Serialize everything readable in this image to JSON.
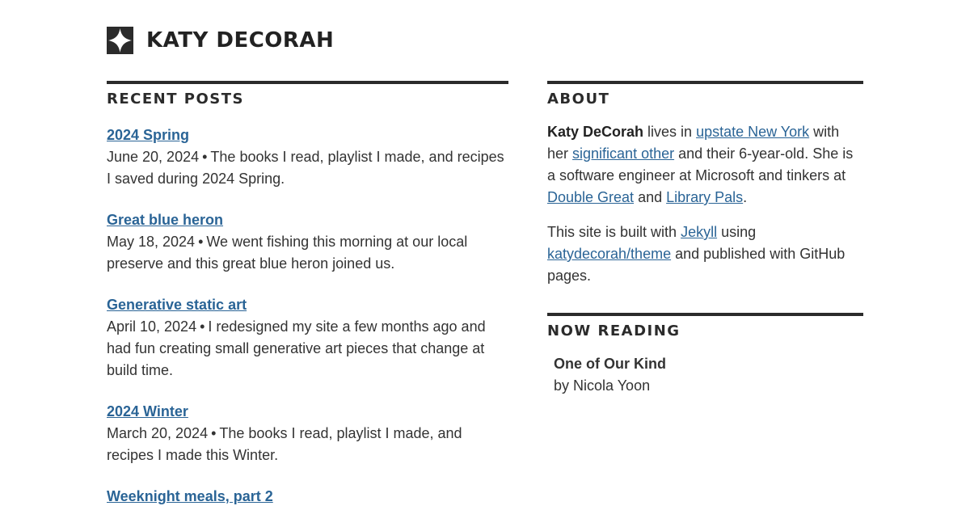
{
  "site": {
    "title": "KATY DECORAH",
    "logo_icon": "four-point-star-icon",
    "colors": {
      "link": "#2a6496",
      "text": "#333333",
      "rule": "#2b2b2b"
    }
  },
  "recent_posts": {
    "heading": "RECENT POSTS",
    "separator": "•",
    "posts": [
      {
        "title": "2024 Spring",
        "date": "June 20, 2024",
        "excerpt": "The books I read, playlist I made, and recipes I saved during 2024 Spring."
      },
      {
        "title": "Great blue heron",
        "date": "May 18, 2024",
        "excerpt": "We went fishing this morning at our local preserve and this great blue heron joined us."
      },
      {
        "title": "Generative static art",
        "date": "April 10, 2024",
        "excerpt": "I redesigned my site a few months ago and had fun creating small generative art pieces that change at build time."
      },
      {
        "title": "2024 Winter",
        "date": "March 20, 2024",
        "excerpt": "The books I read, playlist I made, and recipes I made this Winter."
      },
      {
        "title": "Weeknight meals, part 2",
        "date": "",
        "excerpt": ""
      }
    ]
  },
  "about": {
    "heading": "ABOUT",
    "p1": {
      "name": "Katy DeCorah",
      "t1": " lives in ",
      "link1": "upstate New York",
      "t2": " with her ",
      "link2": "significant other",
      "t3": " and their 6-year-old. She is a software engineer at Microsoft and tinkers at ",
      "link3": "Double Great",
      "t4": " and ",
      "link4": "Library Pals",
      "t5": "."
    },
    "p2": {
      "t1": "This site is built with ",
      "link1": "Jekyll",
      "t2": " using ",
      "link2": "katydecorah/theme",
      "t3": " and published with GitHub pages."
    }
  },
  "now_reading": {
    "heading": "NOW READING",
    "book_title": "One of Our Kind",
    "book_author": "by Nicola Yoon"
  }
}
